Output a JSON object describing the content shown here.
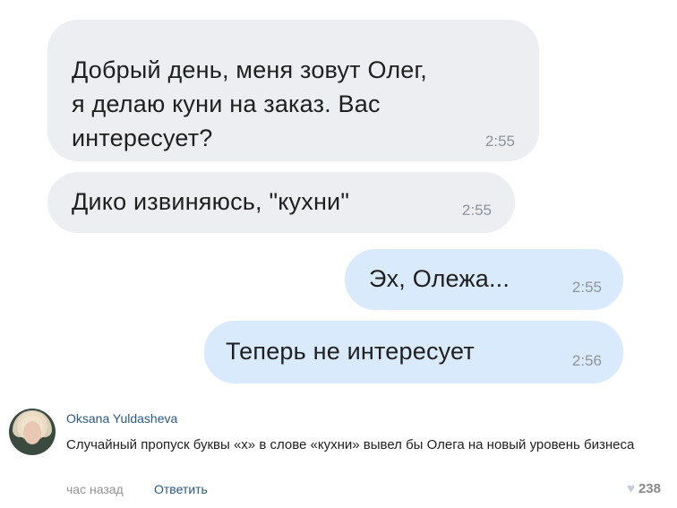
{
  "messages": [
    {
      "text": "Добрый день, меня зовут Олег,\nя делаю куни на заказ. Вас\nинтересует?",
      "time": "2:55",
      "direction": "incoming"
    },
    {
      "text": "Дико извиняюсь, \"кухни\"",
      "time": "2:55",
      "direction": "incoming"
    },
    {
      "text": "Эх, Олежа...",
      "time": "2:55",
      "direction": "outgoing"
    },
    {
      "text": "Теперь не интересует",
      "time": "2:56",
      "direction": "outgoing"
    }
  ],
  "comment": {
    "author": "Oksana Yuldasheva",
    "text": "Случайный пропуск буквы «х» в слове «кухни» вывел бы Олега на новый уровень бизнеса",
    "time_ago": "час назад",
    "reply_label": "Ответить",
    "likes": "238",
    "like_icon": "heart-icon"
  },
  "colors": {
    "incoming_bubble": "#eceef2",
    "outgoing_bubble": "#d9eafc",
    "link": "#2a5885",
    "timestamp": "#8e949b"
  }
}
